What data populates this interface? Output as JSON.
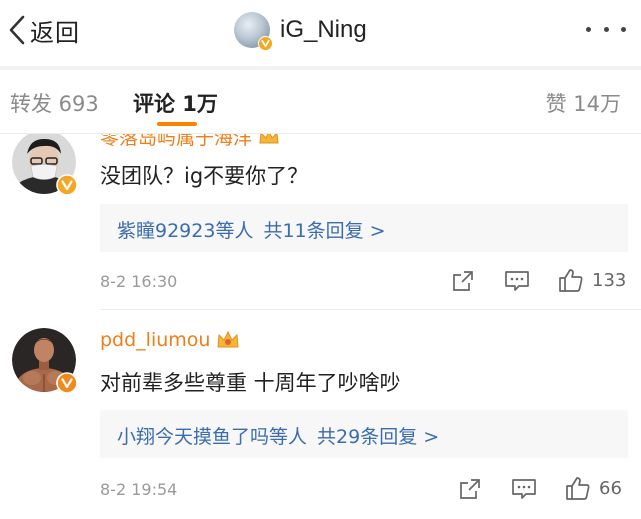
{
  "nav": {
    "back_label": "返回",
    "title": "iG_Ning"
  },
  "tabs": {
    "repost": "转发 693",
    "comment": "评论 1万",
    "like": "赞 14万"
  },
  "colors": {
    "accent": "#ff8200",
    "username": "#f07f19",
    "link": "#3b6cb0",
    "verified_badge": "#f5a623"
  },
  "comments": [
    {
      "username": "零落岛屿属于海洋",
      "text": "没团队？ig不要你了？",
      "reply_people": "紫瞳92923等人",
      "reply_count": "共11条回复 >",
      "time": "8-2 16:30",
      "likes": "133",
      "avatar_icon": "avatar-masked-man-icon"
    },
    {
      "username": "pdd_liumou",
      "text": "对前辈多些尊重 十周年了吵啥吵",
      "reply_people": "小翔今天摸鱼了吗等人",
      "reply_count": "共29条回复 >",
      "time": "8-2 19:54",
      "likes": "66",
      "avatar_icon": "avatar-muscle-man-icon"
    }
  ]
}
